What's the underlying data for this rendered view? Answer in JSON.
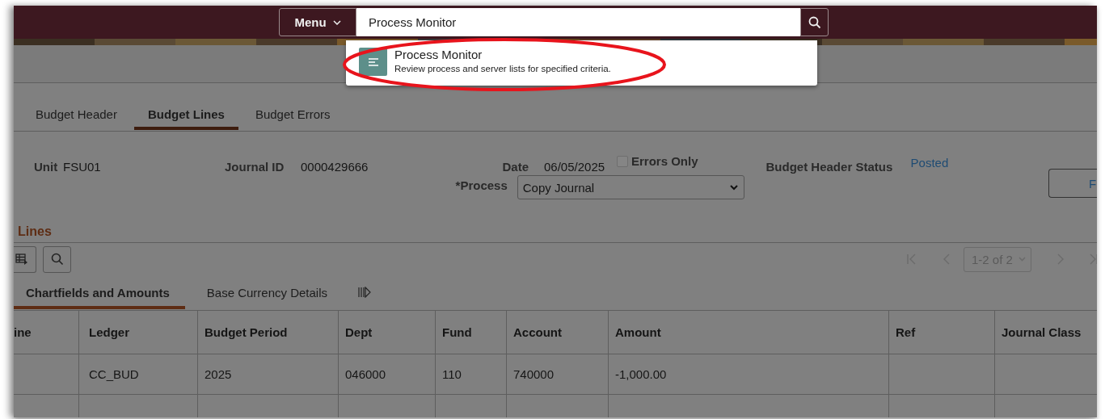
{
  "header": {
    "menu_button": "Menu",
    "search": {
      "value": "Process Monitor"
    }
  },
  "search_results": [
    {
      "title": "Process Monitor",
      "description": "Review process and server lists for specified criteria."
    }
  ],
  "annotations": [
    {
      "kind": "ellipse"
    }
  ],
  "tabs": [
    {
      "label": "Budget Header",
      "selected": false
    },
    {
      "label": "Budget Lines",
      "selected": true
    },
    {
      "label": "Budget Errors",
      "selected": false
    }
  ],
  "form": {
    "unit": {
      "label": "Unit",
      "value": "FSU01"
    },
    "journal_id": {
      "label": "Journal ID",
      "value": "0000429666"
    },
    "date": {
      "label": "Date",
      "value": "06/05/2025"
    },
    "errors_only": {
      "label": "Errors Only",
      "checked": false
    },
    "budget_header_status": {
      "label": "Budget Header Status",
      "value": "Posted"
    },
    "process": {
      "label": "*Process",
      "value": "Copy Journal"
    },
    "button_1": "F"
  },
  "lines": {
    "title": "Lines",
    "pagination": {
      "range": "1-2 of 2"
    },
    "subtabs": [
      {
        "label": "Chartfields and Amounts",
        "selected": true
      },
      {
        "label": "Base Currency Details",
        "selected": false
      }
    ],
    "columns": [
      "ine",
      "Ledger",
      "Budget Period",
      "Dept",
      "Fund",
      "Account",
      "Amount",
      "Ref",
      "Journal Class"
    ],
    "rows": [
      [
        "",
        "CC_BUD",
        "2025",
        "046000",
        "110",
        "740000",
        "-1,000.00",
        "",
        ""
      ]
    ]
  }
}
